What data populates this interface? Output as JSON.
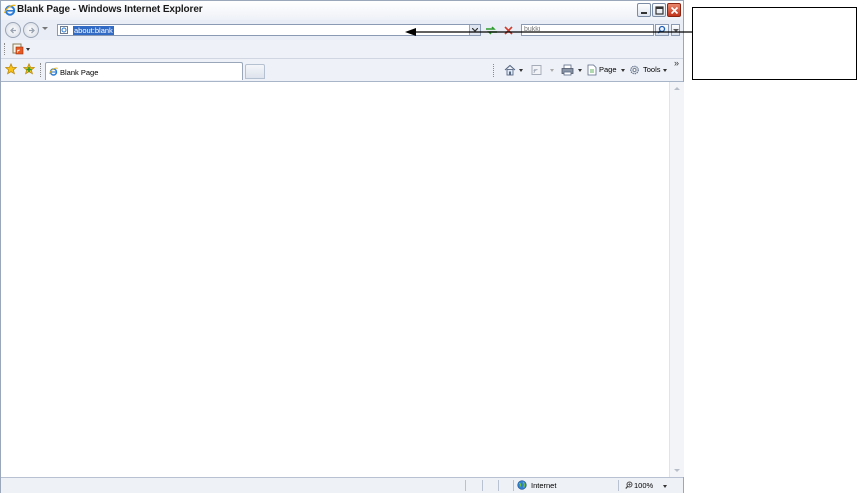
{
  "window": {
    "title": "Blank Page - Windows Internet Explorer"
  },
  "address_bar": {
    "url": "about:blank"
  },
  "search": {
    "placeholder": "bukki"
  },
  "tabs": [
    {
      "label": "Blank Page"
    }
  ],
  "command_bar": {
    "page_label": "Page",
    "tools_label": "Tools"
  },
  "status_bar": {
    "zone": "Internet",
    "zoom": "100%"
  },
  "icons": {
    "back": "back-arrow-icon",
    "forward": "forward-arrow-icon",
    "refresh": "refresh-icon",
    "stop": "stop-icon",
    "search": "magnifier-icon",
    "favorites": "favorites-star-icon",
    "add_favorites": "add-favorites-icon",
    "home": "home-icon",
    "feeds": "rss-feeds-icon",
    "print": "printer-icon",
    "page": "page-icon",
    "tools": "gear-icon",
    "zone": "globe-icon",
    "zoom": "magnifier-zoom-icon"
  },
  "colors": {
    "selection": "#316ac5",
    "close_button": "#c3331b",
    "chrome": "#eef2f8"
  }
}
